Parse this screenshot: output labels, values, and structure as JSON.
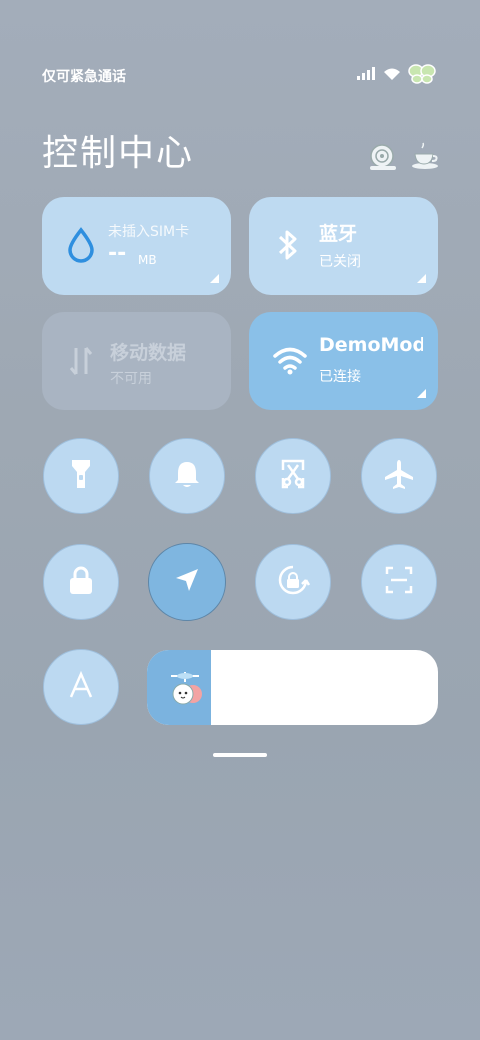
{
  "status_bar": {
    "carrier_text": "仅可紧急通话",
    "icons": [
      "signal-hd-icon",
      "wifi-icon",
      "butterfly-battery-icon"
    ]
  },
  "header": {
    "title": "控制中心",
    "right_icons": [
      "snail-shell-icon",
      "teacup-icon"
    ]
  },
  "tiles": [
    {
      "name": "data-usage",
      "icon": "water-drop-icon",
      "title": "未插入SIM卡",
      "value": "--",
      "unit": "MB",
      "state": "light"
    },
    {
      "name": "bluetooth",
      "icon": "bluetooth-icon",
      "title": "蓝牙",
      "sub": "已关闭",
      "state": "light"
    },
    {
      "name": "mobile-data",
      "icon": "data-arrows-icon",
      "title": "移动数据",
      "sub": "不可用",
      "state": "dim"
    },
    {
      "name": "wifi",
      "icon": "wifi-icon",
      "title": "DemoMode",
      "sub": "已连接",
      "state": "active"
    }
  ],
  "toggles_row1": [
    "flashlight-icon",
    "bell-icon",
    "screenshot-scissors-icon",
    "airplane-icon"
  ],
  "toggles_row2": [
    "lock-icon",
    "location-arrow-icon",
    "auto-rotate-icon",
    "scan-icon"
  ],
  "toggles_row3": [
    "font-size-icon"
  ],
  "brightness": {
    "level_percent": 22,
    "knob_icon": "cute-character-icon"
  },
  "colors": {
    "tile_light": "#bedaf1",
    "tile_active": "#8ac0e8",
    "tile_dim": "#a9b4c2",
    "accent_drop": "#2f8fdf"
  }
}
